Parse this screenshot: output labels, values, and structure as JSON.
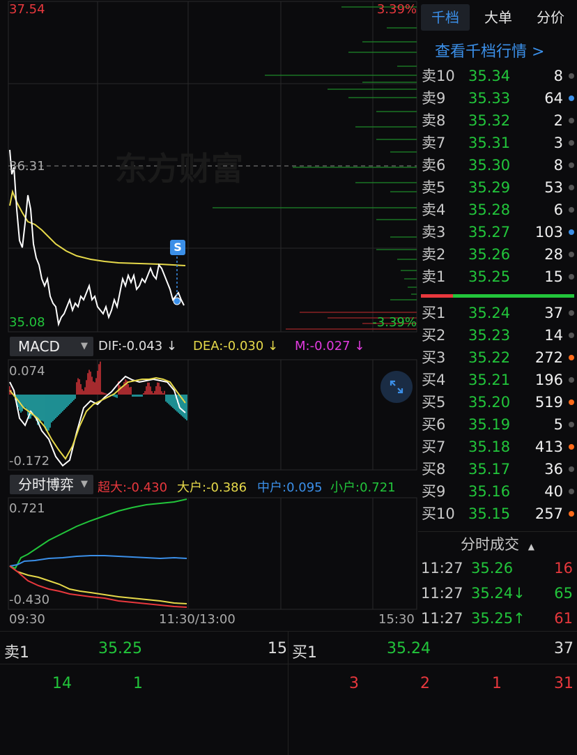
{
  "tabs": [
    "千档",
    "大单",
    "分价"
  ],
  "order_book_link": "查看千档行情 >",
  "price_chart": {
    "high_label": "37.54",
    "low_label": "35.08",
    "prev_close_label": "36.31",
    "pct_high": "3.39%",
    "pct_low": "-3.39%",
    "watermark": "东方财富",
    "marker": "S"
  },
  "macd": {
    "selector": "MACD",
    "dif": "DIF:-0.043 ↓",
    "dea": "DEA:-0.030 ↓",
    "m": "M:-0.027 ↓",
    "top_label": "0.074",
    "bottom_label": "-0.172"
  },
  "game": {
    "selector": "分时博弈",
    "super": "超大:-0.430",
    "big": "大户:-0.386",
    "mid": "中户:0.095",
    "small": "小户:0.721",
    "top_label": "0.721",
    "bottom_label": "-0.430"
  },
  "time_axis": [
    "09:30",
    "11:30/13:00",
    "15:30"
  ],
  "sell_orders": [
    {
      "label": "卖10",
      "price": "35.34",
      "vol": "8",
      "dot": "gray"
    },
    {
      "label": "卖9",
      "price": "35.33",
      "vol": "64",
      "dot": "blue"
    },
    {
      "label": "卖8",
      "price": "35.32",
      "vol": "2",
      "dot": "gray"
    },
    {
      "label": "卖7",
      "price": "35.31",
      "vol": "3",
      "dot": "gray"
    },
    {
      "label": "卖6",
      "price": "35.30",
      "vol": "8",
      "dot": "gray"
    },
    {
      "label": "卖5",
      "price": "35.29",
      "vol": "53",
      "dot": "gray"
    },
    {
      "label": "卖4",
      "price": "35.28",
      "vol": "6",
      "dot": "gray"
    },
    {
      "label": "卖3",
      "price": "35.27",
      "vol": "103",
      "dot": "blue"
    },
    {
      "label": "卖2",
      "price": "35.26",
      "vol": "28",
      "dot": "gray"
    },
    {
      "label": "卖1",
      "price": "35.25",
      "vol": "15",
      "dot": "gray"
    }
  ],
  "buy_orders": [
    {
      "label": "买1",
      "price": "35.24",
      "vol": "37",
      "dot": "gray"
    },
    {
      "label": "买2",
      "price": "35.23",
      "vol": "14",
      "dot": "gray"
    },
    {
      "label": "买3",
      "price": "35.22",
      "vol": "272",
      "dot": "orange"
    },
    {
      "label": "买4",
      "price": "35.21",
      "vol": "196",
      "dot": "gray"
    },
    {
      "label": "买5",
      "price": "35.20",
      "vol": "519",
      "dot": "orange"
    },
    {
      "label": "买6",
      "price": "35.19",
      "vol": "5",
      "dot": "gray"
    },
    {
      "label": "买7",
      "price": "35.18",
      "vol": "413",
      "dot": "orange"
    },
    {
      "label": "买8",
      "price": "35.17",
      "vol": "36",
      "dot": "gray"
    },
    {
      "label": "买9",
      "price": "35.16",
      "vol": "40",
      "dot": "gray"
    },
    {
      "label": "买10",
      "price": "35.15",
      "vol": "257",
      "dot": "orange"
    }
  ],
  "trades_title": "分时成交",
  "trades": [
    {
      "time": "11:27",
      "price": "35.26",
      "vol": "16",
      "color": "#e8383d"
    },
    {
      "time": "11:27",
      "price": "35.24↓",
      "vol": "65",
      "color": "#22c53b"
    },
    {
      "time": "11:27",
      "price": "35.25↑",
      "vol": "61",
      "color": "#e8383d"
    }
  ],
  "bottom": {
    "sell_label": "卖1",
    "sell_price": "35.25",
    "sell_vol": "15",
    "buy_label": "买1",
    "buy_price": "35.24",
    "buy_vol": "37",
    "left_queue": [
      "14",
      "1"
    ],
    "right_queue": [
      "3",
      "2",
      "1",
      "31"
    ]
  },
  "colors": {
    "up": "#e8383d",
    "down": "#22c53b",
    "accent": "#3b8fe8",
    "yellow": "#e6d94a",
    "magenta": "#e23be0"
  }
}
